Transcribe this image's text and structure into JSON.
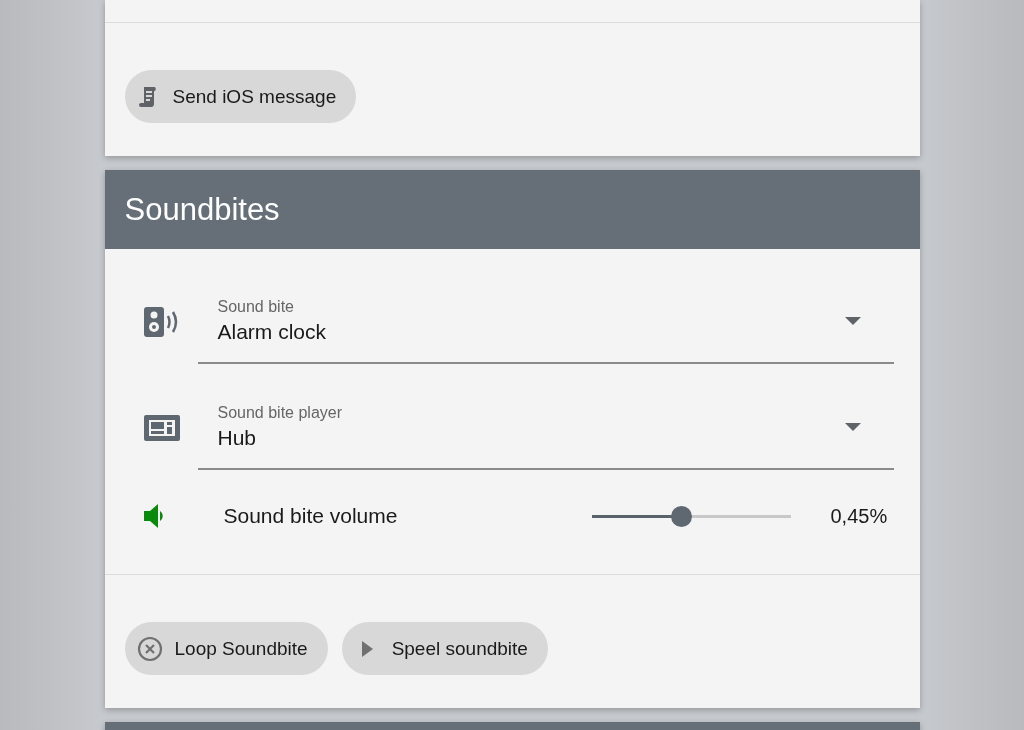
{
  "top_card": {
    "buttons": [
      {
        "label": "Send iOS message"
      }
    ]
  },
  "soundbites": {
    "title": "Soundbites",
    "rows": [
      {
        "kind": "select",
        "label": "Sound bite",
        "value": "Alarm clock"
      },
      {
        "kind": "select",
        "label": "Sound bite player",
        "value": "Hub"
      },
      {
        "kind": "slider",
        "label": "Sound bite volume",
        "level": 0.45,
        "reading": "0,45%"
      }
    ],
    "buttons": [
      {
        "label": "Loop Soundbite"
      },
      {
        "label": "Speel soundbite"
      }
    ]
  }
}
